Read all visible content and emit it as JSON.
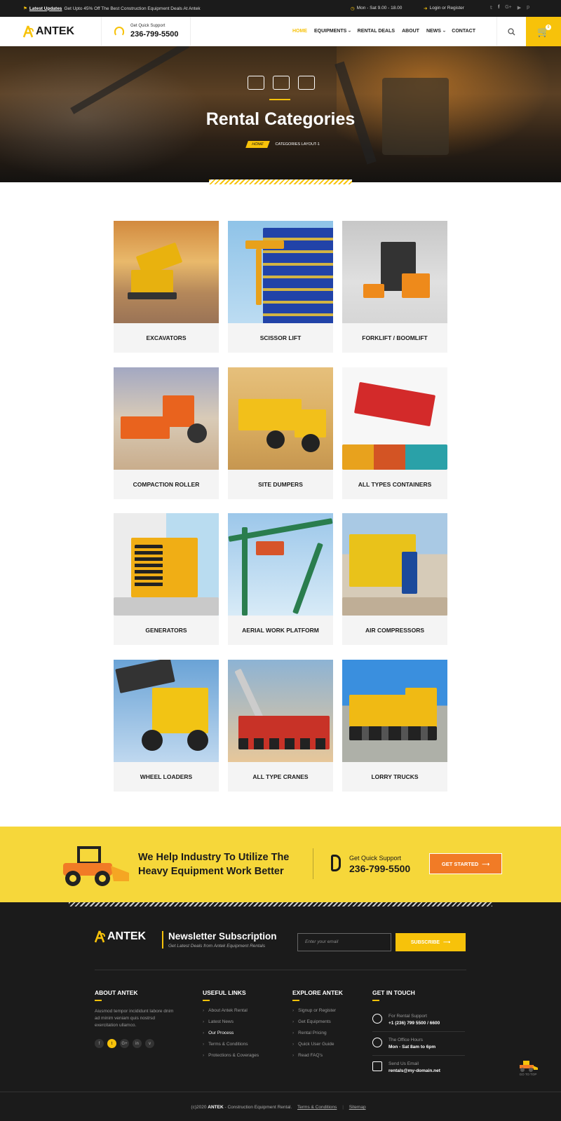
{
  "topbar": {
    "news_label": "Latest Updates",
    "news_text": "Get Upto 45% Off The Best Construction Equipment Deals At Antek",
    "hours": "Mon - Sat  9.00 - 18.00",
    "login": "Login or Register",
    "social_icons": [
      "twitter-icon",
      "facebook-icon",
      "google-plus-icon",
      "youtube-icon",
      "pinterest-icon"
    ]
  },
  "header": {
    "brand": "ANTEK",
    "support_label": "Get Quick Support",
    "support_phone": "236-799-5500",
    "nav": [
      {
        "label": "HOME",
        "active": true,
        "dropdown": false
      },
      {
        "label": "EQUIPMENTS",
        "active": false,
        "dropdown": true
      },
      {
        "label": "RENTAL DEALS",
        "active": false,
        "dropdown": false
      },
      {
        "label": "ABOUT",
        "active": false,
        "dropdown": false
      },
      {
        "label": "NEWS",
        "active": false,
        "dropdown": true
      },
      {
        "label": "CONTACT",
        "active": false,
        "dropdown": false
      }
    ],
    "cart_count": "0"
  },
  "hero": {
    "title": "Rental Categories",
    "breadcrumb_home": "HOME",
    "breadcrumb_current": "CATEGORIES LAYOUT-1"
  },
  "categories": [
    {
      "label": "EXCAVATORS",
      "theme": "sunset-excavator"
    },
    {
      "label": "SCISSOR LIFT",
      "theme": "blue-building"
    },
    {
      "label": "FORKLIFT / BOOMLIFT",
      "theme": "warehouse-forklift"
    },
    {
      "label": "COMPACTION ROLLER",
      "theme": "orange-roller"
    },
    {
      "label": "SITE DUMPERS",
      "theme": "yellow-dumper"
    },
    {
      "label": "ALL TYPES CONTAINERS",
      "theme": "red-container"
    },
    {
      "label": "GENERATORS",
      "theme": "yellow-generator"
    },
    {
      "label": "AERIAL WORK PLATFORM",
      "theme": "green-platform"
    },
    {
      "label": "AIR COMPRESSORS",
      "theme": "yellow-compressor"
    },
    {
      "label": "WHEEL LOADERS",
      "theme": "yellow-loader"
    },
    {
      "label": "ALL TYPE CRANES",
      "theme": "red-crane"
    },
    {
      "label": "LORRY TRUCKS",
      "theme": "yellow-truck"
    }
  ],
  "cta": {
    "message_line1": "We Help Industry To Utilize The",
    "message_line2": "Heavy Equipment Work Better",
    "support_label": "Get Quick Support",
    "support_phone": "236-799-5500",
    "button": "GET STARTED"
  },
  "footer": {
    "brand": "ANTEK",
    "newsletter_title": "Newsletter Subscription",
    "newsletter_sub": "Get Latest Deals from Antek Equipment Rentals",
    "email_placeholder": "Enter your email",
    "subscribe": "SUBSCRIBE",
    "about_title": "ABOUT ANTEK",
    "about_text": "Aiusmod tempor incididunt labore dnim ad minim veniam quis nostrsd exercitation ullamco.",
    "about_social": [
      "f",
      "t",
      "G+",
      "in",
      "v"
    ],
    "useful_title": "USEFUL LINKS",
    "useful_links": [
      "About Antek Rental",
      "Latest News",
      "Our Process",
      "Terms & Conditions",
      "Protections & Coverages"
    ],
    "explore_title": "EXPLORE ANTEK",
    "explore_links": [
      "Signup or Register",
      "Get Equipments",
      "Rental Pricing",
      "Quick User Guide",
      "Read FAQ's"
    ],
    "contact_title": "GET IN TOUCH",
    "contact": [
      {
        "label": "For Rental Support",
        "value": "+1 (236) 799 5500 / 6600"
      },
      {
        "label": "The Office Hours",
        "value": "Mon - Sat 8am to 6pm"
      },
      {
        "label": "Send Us Email",
        "value": "rentals@my-domain.net"
      }
    ],
    "go_to_top": "GO TO TOP",
    "copyright_pre": "(c)2020",
    "copyright_brand": "ANTEK",
    "copyright_post": "- Construction Equipment Rental.",
    "terms": "Terms & Conditions",
    "sitemap": "Sitemap"
  }
}
